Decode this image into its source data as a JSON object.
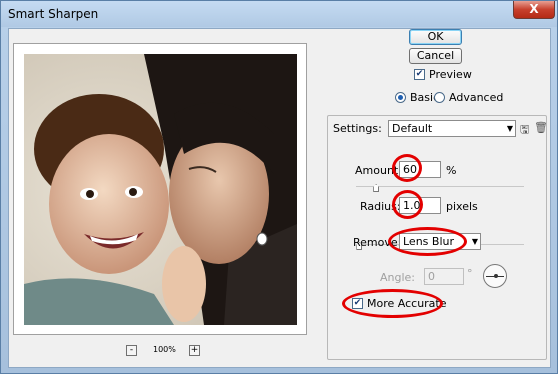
{
  "window": {
    "title": "Smart Sharpen",
    "close_glyph": "X"
  },
  "preview": {
    "zoom": "100%",
    "zoom_out": "-",
    "zoom_in": "+"
  },
  "buttons": {
    "ok": "OK",
    "cancel": "Cancel"
  },
  "preview_toggle": {
    "label": "Preview",
    "checked": true
  },
  "mode": {
    "basic": "Basic",
    "advanced": "Advanced",
    "selected": "Basic"
  },
  "settings": {
    "label": "Settings:",
    "value": "Default"
  },
  "amount": {
    "label": "Amount:",
    "value": "60",
    "unit": "%",
    "slider_fraction": 0.12
  },
  "radius": {
    "label": "Radius:",
    "value": "1.0",
    "unit": "pixels",
    "slider_fraction": 0.02
  },
  "remove": {
    "label": "Remove:",
    "value": "Lens Blur"
  },
  "angle": {
    "label": "Angle:",
    "value": "0",
    "unit": "°"
  },
  "more_accurate": {
    "label": "More Accurate",
    "checked": true
  },
  "highlight_color": "#e30000",
  "icons": {
    "save": "save-icon",
    "delete": "trash-icon"
  }
}
